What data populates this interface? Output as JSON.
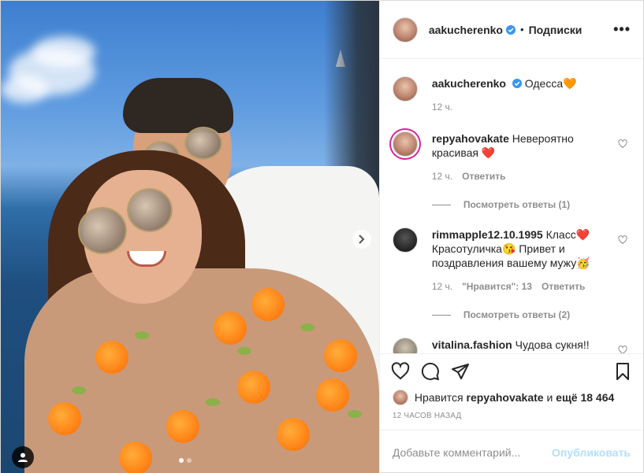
{
  "post": {
    "author": "aakucherenko",
    "follow_label": "Подписки",
    "more_label": "•••",
    "caption_author": "aakucherenko",
    "caption_text": "Одесса",
    "caption_emoji": "🧡",
    "caption_time": "12 ч."
  },
  "comments": [
    {
      "user": "repyahovakate",
      "text": "Невероятно красивая",
      "emoji": "❤️",
      "time": "12 ч.",
      "likes_label": "",
      "reply_label": "Ответить",
      "view_replies": "Посмотреть ответы (1)"
    },
    {
      "user": "rimmapple12.10.1995",
      "text": "Класс",
      "emoji": "❤️",
      "text2": "Красотуличка",
      "emoji2": "😘",
      "text3": "Привет и поздравления вашему мужу",
      "emoji3": "🥳",
      "time": "12 ч.",
      "likes_label": "\"Нравится\": 13",
      "reply_label": "Ответить",
      "view_replies": "Посмотреть ответы (2)"
    },
    {
      "user": "vitalina.fashion",
      "text": "Чудова сукня!!"
    }
  ],
  "likes": {
    "prefix": "Нравится",
    "user": "repyahovakate",
    "middle": "и",
    "others": "ещё 18 464"
  },
  "time_ago": "12 часов назад",
  "add_comment": {
    "placeholder": "Добавьте комментарий...",
    "publish_label": "Опубликовать"
  },
  "colors": {
    "verified": "#3897f0",
    "ring": "#d6249f",
    "publish_disabled": "#b2dffc"
  },
  "icons": [
    "heart-icon",
    "comment-icon",
    "share-icon",
    "bookmark-icon",
    "chevron-right-icon",
    "user-tag-icon",
    "verified-icon",
    "more-icon"
  ],
  "carousel": {
    "slides": 2,
    "active": 1
  }
}
